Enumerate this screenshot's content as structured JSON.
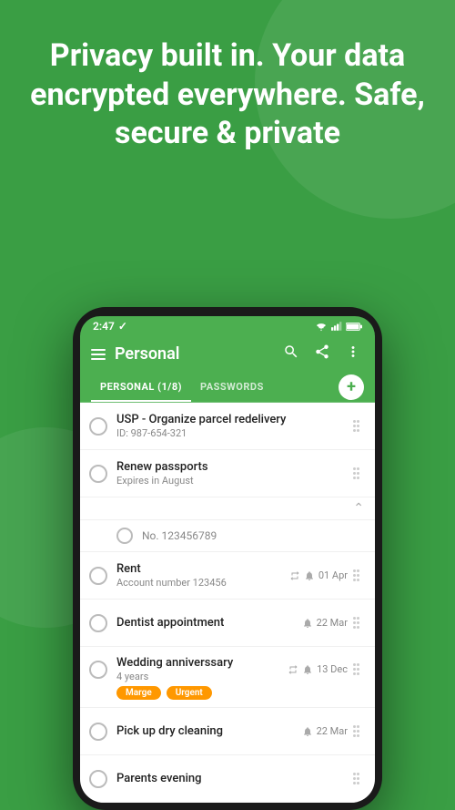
{
  "hero": {
    "text": "Privacy built in. Your data encrypted everywhere. Safe, secure & private"
  },
  "status_bar": {
    "time": "2:47",
    "tick": "✓"
  },
  "app_bar": {
    "title": "Personal",
    "menu_icon": "menu-icon",
    "search_icon": "search-icon",
    "share_icon": "share-icon",
    "more_icon": "more-icon"
  },
  "tabs": [
    {
      "label": "PERSONAL (1/8)",
      "active": true
    },
    {
      "label": "PASSWORDS",
      "active": false
    }
  ],
  "add_button_label": "+",
  "list_items": [
    {
      "id": "item-1",
      "title": "USP - Organize parcel redelivery",
      "subtitle": "ID: 987-654-321",
      "meta": null,
      "checked": false,
      "tags": []
    },
    {
      "id": "item-2",
      "title": "Renew passports",
      "subtitle": "Expires in August",
      "meta": null,
      "checked": false,
      "tags": [],
      "has_expand": true
    },
    {
      "id": "item-2-sub",
      "title": "No. 123456789",
      "subtitle": null,
      "is_sub": true
    },
    {
      "id": "item-3",
      "title": "Rent",
      "subtitle": "Account number 123456",
      "meta": "01 Apr",
      "has_repeat": true,
      "has_bell": true,
      "checked": false,
      "tags": []
    },
    {
      "id": "item-4",
      "title": "Dentist appointment",
      "subtitle": null,
      "meta": "22 Mar",
      "has_bell": true,
      "checked": false,
      "tags": []
    },
    {
      "id": "item-5",
      "title": "Wedding anniverssary",
      "subtitle": "4 years",
      "meta": "13 Dec",
      "has_repeat": true,
      "has_bell": true,
      "checked": false,
      "tags": [
        "Marge",
        "Urgent"
      ]
    },
    {
      "id": "item-6",
      "title": "Pick up dry cleaning",
      "subtitle": null,
      "meta": "22 Mar",
      "has_bell": true,
      "checked": false,
      "tags": []
    },
    {
      "id": "item-7",
      "title": "Parents evening",
      "subtitle": null,
      "meta": null,
      "checked": false,
      "tags": []
    }
  ]
}
